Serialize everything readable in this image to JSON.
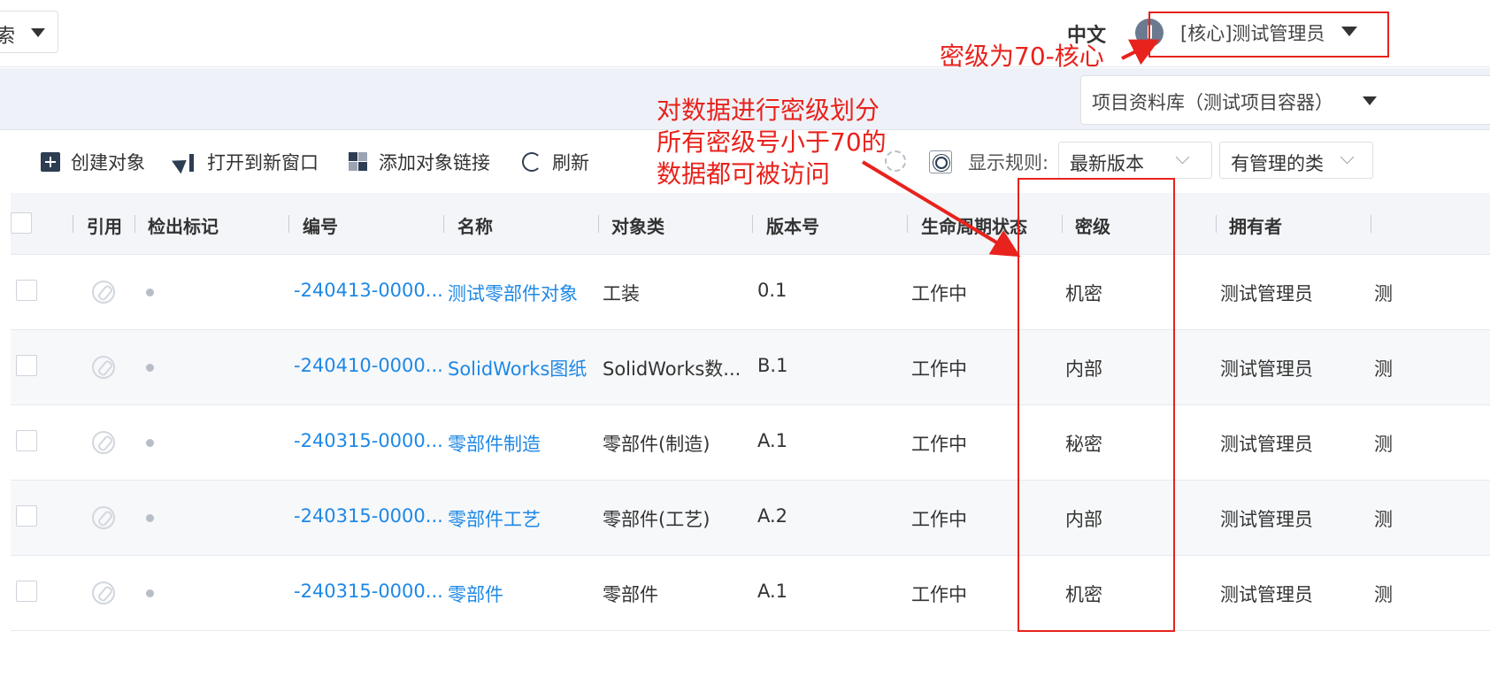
{
  "header": {
    "search_scope": "索",
    "language": "中文",
    "user_name": "[核心]测试管理员"
  },
  "subbar": {
    "container": "项目资料库（测试项目容器）"
  },
  "toolbar": {
    "create": "创建对象",
    "open_new_window": "打开到新窗口",
    "add_link": "添加对象链接",
    "refresh": "刷新",
    "rule_label": "显示规则:",
    "version_filter": "最新版本",
    "class_filter": "有管理的类"
  },
  "table": {
    "columns": [
      "引用",
      "检出标记",
      "编号",
      "名称",
      "对象类",
      "版本号",
      "生命周期状态",
      "密级",
      "拥有者"
    ],
    "rows": [
      {
        "number": "-240413-0000...",
        "name": "测试零部件对象",
        "class": "工装",
        "version": "0.1",
        "state": "工作中",
        "secret": "机密",
        "owner": "测试管理员",
        "extra": "测"
      },
      {
        "number": "-240410-0000...",
        "name": "SolidWorks图纸",
        "class": "SolidWorks数...",
        "version": "B.1",
        "state": "工作中",
        "secret": "内部",
        "owner": "测试管理员",
        "extra": "测"
      },
      {
        "number": "-240315-0000...",
        "name": "零部件制造",
        "class": "零部件(制造)",
        "version": "A.1",
        "state": "工作中",
        "secret": "秘密",
        "owner": "测试管理员",
        "extra": "测"
      },
      {
        "number": "-240315-0000...",
        "name": "零部件工艺",
        "class": "零部件(工艺)",
        "version": "A.2",
        "state": "工作中",
        "secret": "内部",
        "owner": "测试管理员",
        "extra": "测"
      },
      {
        "number": "-240315-0000...",
        "name": "零部件",
        "class": "零部件",
        "version": "A.1",
        "state": "工作中",
        "secret": "机密",
        "owner": "测试管理员",
        "extra": "测"
      }
    ]
  },
  "annotations": {
    "user_note": "密级为70-核心",
    "data_note_lines": [
      "对数据进行密级划分",
      "所有密级号小于70的",
      "数据都可被访问"
    ],
    "color": "#e8221c"
  }
}
